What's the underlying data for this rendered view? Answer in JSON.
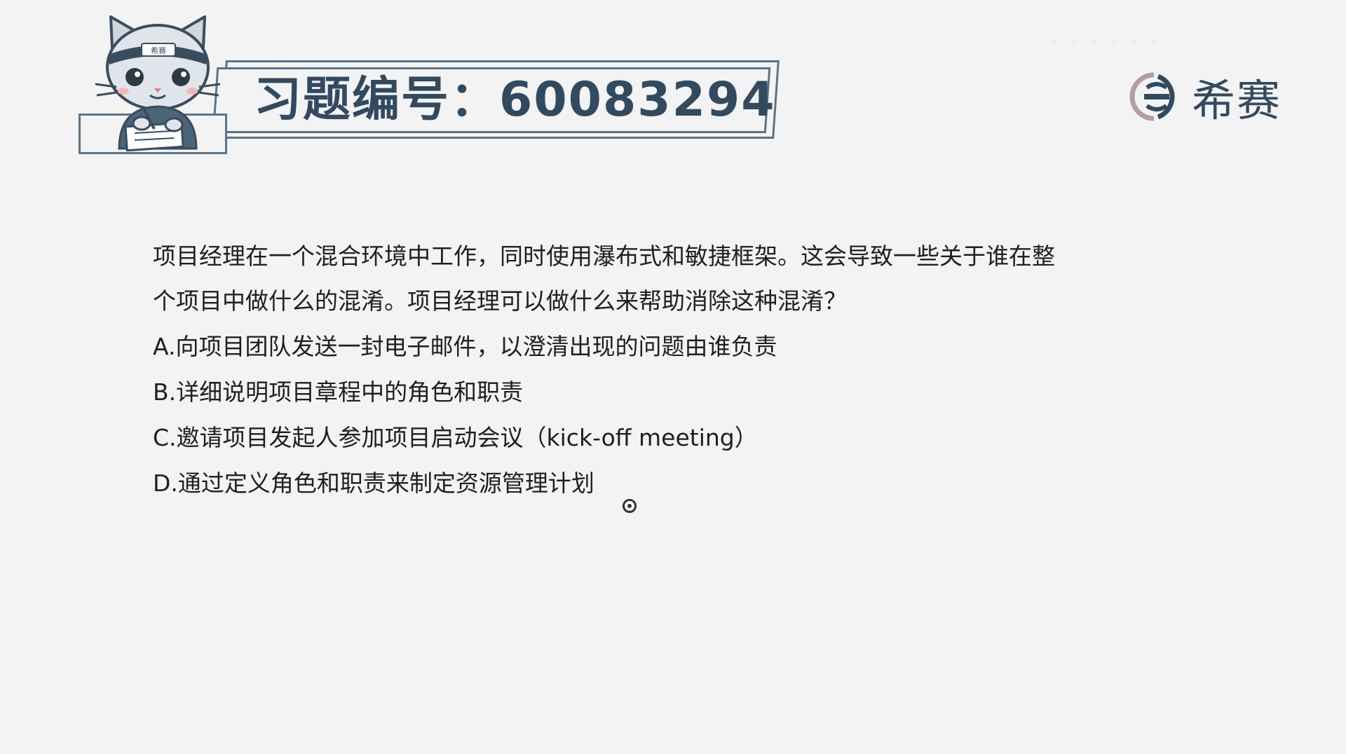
{
  "header": {
    "title": "习题编号：60083294",
    "mascot_badge": "希赛"
  },
  "logo": {
    "text": "希赛",
    "icon": "xisai-logo-icon",
    "brand_color": "#324a60"
  },
  "question": {
    "stem_lines": [
      "项目经理在一个混合环境中工作，同时使用瀑布式和敏捷框架。这会导致一些关于谁在整",
      "个项目中做什么的混淆。项目经理可以做什么来帮助消除这种混淆？"
    ],
    "options": [
      "A.向项目团队发送一封电子邮件，以澄清出现的问题由谁负责",
      "B.详细说明项目章程中的角色和职责",
      "C.邀请项目发起人参加项目启动会议（kick-off meeting）",
      "D.通过定义角色和职责来制定资源管理计划"
    ]
  },
  "colors": {
    "background": "#f3f3f3",
    "accent": "#5a7388",
    "title": "#324a60",
    "text": "#1f1f1f"
  }
}
